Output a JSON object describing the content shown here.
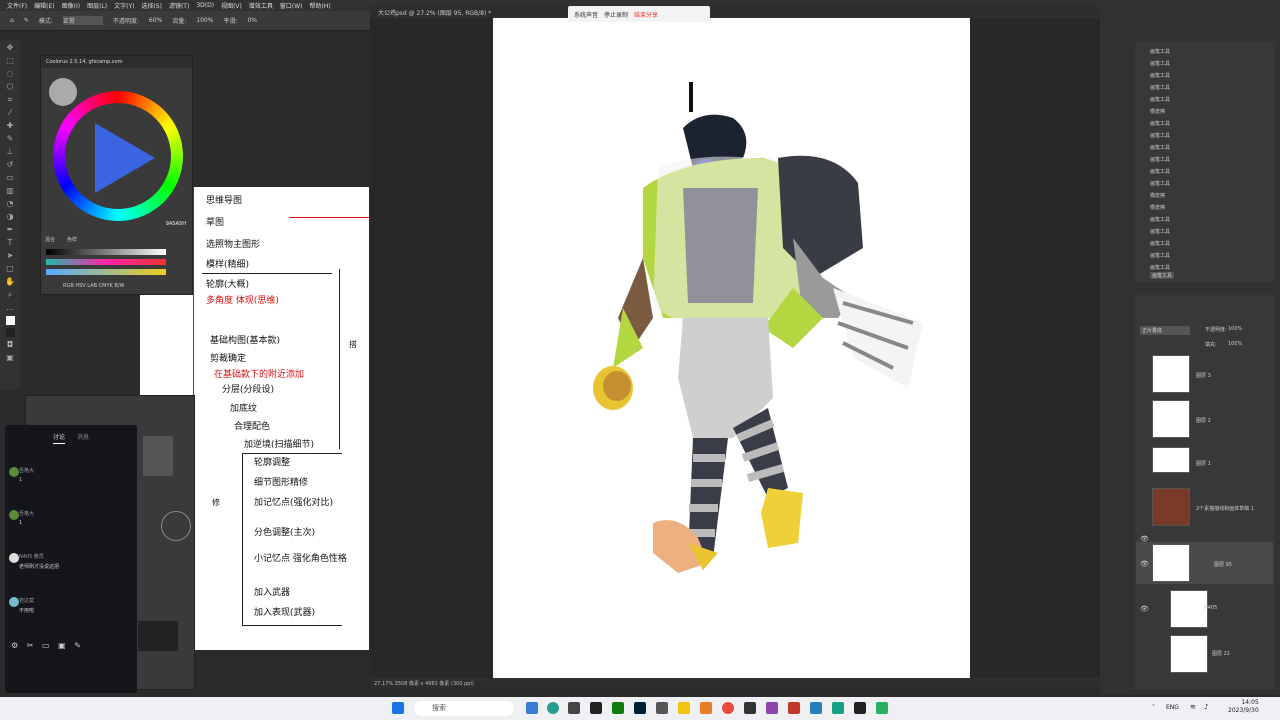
{
  "menu": [
    "文件(F)",
    "编辑(E)",
    "图像(I)",
    "图层(L)",
    "文字(Y)",
    "选择(S)",
    "滤镜(T)",
    "3D(D)",
    "视图(V)",
    "增效工具",
    "窗口(W)",
    "帮助(H)"
  ],
  "options": {
    "mode_label": "模式:",
    "mode_value": "正常",
    "opacity_label": "不透明度:",
    "opacity_value": "60%",
    "flow_label": "流量:",
    "flow_value": "100%",
    "smooth_label": "平滑:",
    "smooth_value": "0%"
  },
  "color_panel": {
    "title": "Coolorus 2.5.14, gfxcamp.com",
    "mode_labels": "RGB HSV LAB CMYK B/W",
    "brand": "9ASASH",
    "tab1": "混合",
    "tab2": "色样"
  },
  "notes": {
    "items": [
      "思维导图",
      "草图",
      "选照物主图形",
      "模样(精细)",
      "轮廓(大概)",
      "多角度 体现(思维)",
      "基础构图(基本款)",
      "剪裁确定",
      "在基础款下的附近添加",
      "分层(分段设)",
      "加底纹",
      "合理配色",
      "加逆境(扫描细节)",
      "轮廓调整",
      "细节图形精修",
      "加记忆点(强化对比)",
      "分色调整(主次)",
      "小记忆点 强化角色性格",
      "加入武器",
      "加入表现(武器)"
    ],
    "side_marks": [
      "搭",
      "修"
    ]
  },
  "chat": {
    "tab1": "讨论",
    "tab2": "消息",
    "messages": [
      {
        "name": "吾格大",
        "text": "1"
      },
      {
        "name": "吾格大",
        "text": "1"
      },
      {
        "name": "N405 教员",
        "text": "老师刚才没说这把"
      },
      {
        "name": "若达莫",
        "text": "不用啦"
      }
    ]
  },
  "canvas": {
    "title": "大公鸡psd @ 27.2% (图层 95, RGB/8) *",
    "status": "27.17%  3508 像素 x 4961 像素 (300 ppi)"
  },
  "recording": {
    "mic": "系统声音",
    "stop": "停止录制",
    "share": "结束分享"
  },
  "history": {
    "items": [
      "画笔工具",
      "画笔工具",
      "画笔工具",
      "画笔工具",
      "画笔工具",
      "橡皮擦",
      "画笔工具",
      "画笔工具",
      "画笔工具",
      "画笔工具",
      "画笔工具",
      "画笔工具",
      "橡皮擦",
      "橡皮擦",
      "画笔工具",
      "画笔工具",
      "画笔工具",
      "画笔工具",
      "画笔工具",
      "画笔工具"
    ]
  },
  "layers": {
    "blend": "正片叠底",
    "opacity_label": "不透明度:",
    "opacity": "100%",
    "fill_label": "填充:",
    "fill": "100%",
    "items": [
      {
        "name": "图层 3"
      },
      {
        "name": "图层 2"
      },
      {
        "name": "图层 1"
      },
      {
        "name": "2个素描描线和画体草稿 1"
      },
      {
        "name": "图层 95"
      },
      {
        "name": "N405"
      },
      {
        "name": "图层 21"
      }
    ]
  },
  "taskbar": {
    "search": "搜索",
    "lang": "ENG",
    "time": "14:05",
    "date": "2023/9/30"
  }
}
